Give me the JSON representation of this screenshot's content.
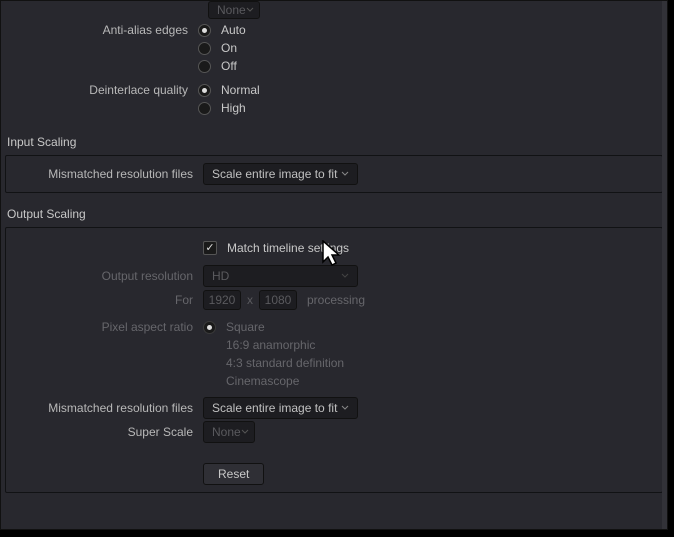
{
  "anti_alias": {
    "label": "Anti-alias edges",
    "options": [
      "Auto",
      "On",
      "Off"
    ],
    "selected": "Auto"
  },
  "deinterlace": {
    "label": "Deinterlace quality",
    "options": [
      "Normal",
      "High"
    ],
    "selected": "Normal"
  },
  "top_none": {
    "value": "None"
  },
  "input_scaling": {
    "header": "Input Scaling",
    "mismatch_label": "Mismatched resolution files",
    "mismatch_value": "Scale entire image to fit"
  },
  "output_scaling": {
    "header": "Output Scaling",
    "match_timeline": "Match timeline settings",
    "match_checked": true,
    "res_label": "Output resolution",
    "res_value": "HD",
    "for_label": "For",
    "width": "1920",
    "x": "x",
    "height": "1080",
    "processing": "processing",
    "par_label": "Pixel aspect ratio",
    "par_options": [
      "Square",
      "16:9 anamorphic",
      "4:3 standard definition",
      "Cinemascope"
    ],
    "par_selected": "Square",
    "mismatch_label": "Mismatched resolution files",
    "mismatch_value": "Scale entire image to fit",
    "super_label": "Super Scale",
    "super_value": "None",
    "reset": "Reset"
  }
}
